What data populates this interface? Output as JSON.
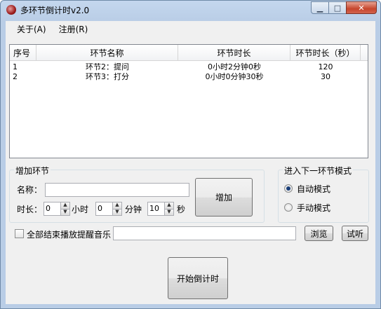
{
  "window": {
    "title": "多环节倒计时v2.0",
    "controls": {
      "minimize": "▁",
      "maximize": "□",
      "close": "✕"
    }
  },
  "menu": {
    "items": [
      "关于(A)",
      "注册(R)"
    ]
  },
  "list": {
    "columns": [
      "序号",
      "环节名称",
      "环节时长",
      "环节时长（秒）"
    ],
    "rows": [
      [
        "1",
        "环节2：提问",
        "0小时2分钟0秒",
        "120"
      ],
      [
        "2",
        "环节3：打分",
        "0小时0分钟30秒",
        "30"
      ]
    ]
  },
  "add_section": {
    "title": "增加环节",
    "name_label": "名称：",
    "name_value": "",
    "duration_label": "时长：",
    "hours_value": "0",
    "hours_unit": "小时",
    "minutes_value": "0",
    "minutes_unit": "分钟",
    "seconds_value": "10",
    "seconds_unit": "秒",
    "add_button": "增加"
  },
  "mode_section": {
    "title": "进入下一环节模式",
    "options": [
      {
        "label": "自动模式",
        "checked": true
      },
      {
        "label": "手动模式",
        "checked": false
      }
    ]
  },
  "music": {
    "checkbox_label": "全部结束播放提醒音乐",
    "checked": false,
    "path_value": "",
    "browse_button": "浏览",
    "listen_button": "试听"
  },
  "start_button": "开始倒计时"
}
